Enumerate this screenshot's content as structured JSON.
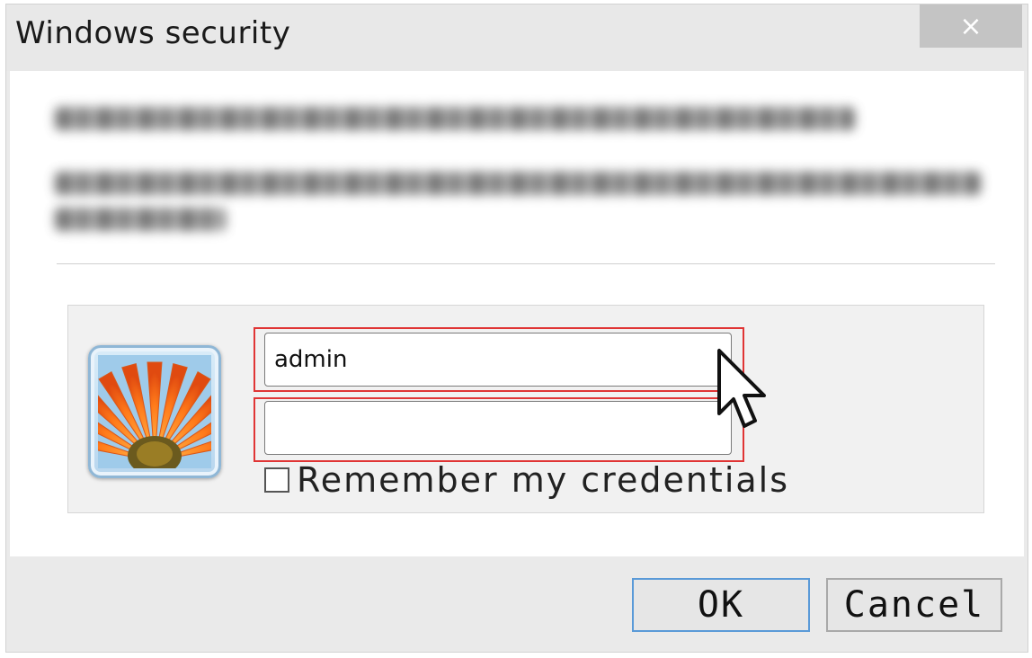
{
  "window": {
    "title": "Windows security",
    "close_glyph": "×"
  },
  "message": {
    "obscured": true
  },
  "credentials": {
    "avatar_icon": "user-avatar-flower-icon",
    "username_value": "admin",
    "password_value": "",
    "remember_label": "Remember my credentials",
    "remember_checked": false
  },
  "buttons": {
    "ok_label": "OK",
    "cancel_label": "Cancel"
  },
  "colors": {
    "highlight": "#e03535",
    "focus_border": "#5a9ad8"
  }
}
